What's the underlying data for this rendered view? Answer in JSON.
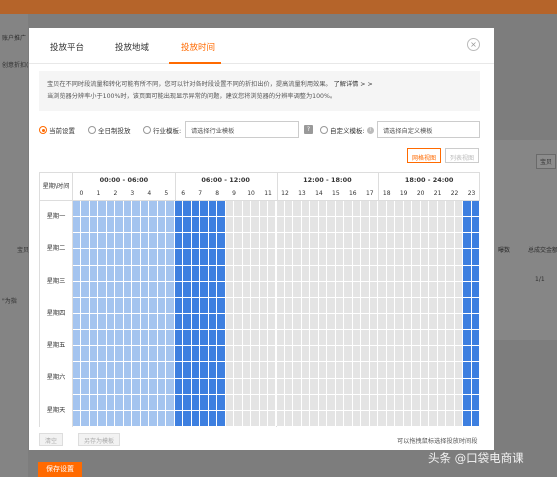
{
  "tabs": [
    {
      "label": "投放平台",
      "active": false
    },
    {
      "label": "投放地域",
      "active": false
    },
    {
      "label": "投放时间",
      "active": true
    }
  ],
  "close_icon": "×",
  "notice": {
    "line1": "宝贝在不同时段流量和转化可能有所不同，您可以针对各时段设置不同的折扣出价，提高流量利用效果。",
    "link": "了解详情 > >",
    "line2": "当浏览器分辨率小于100%时，该页面可能出现显示异常的问题，建议您将浏览器的分辨率调整为100%。"
  },
  "options": {
    "current": "当前设置",
    "allday": "全日制投放",
    "industry": "行业模板:",
    "industry_placeholder": "请选择行业模板",
    "custom": "自定义模板:",
    "custom_placeholder": "请选择自定义模板",
    "help_icon": "?",
    "info_icon": "i"
  },
  "views": {
    "grid": "网格视图",
    "list": "列表视图"
  },
  "grid": {
    "corner": "星期\\时间",
    "periods": [
      "00:00 - 06:00",
      "06:00 - 12:00",
      "12:00 - 18:00",
      "18:00 - 24:00"
    ],
    "hours": [
      "0",
      "1",
      "2",
      "3",
      "4",
      "5",
      "6",
      "7",
      "8",
      "9",
      "10",
      "11",
      "12",
      "13",
      "14",
      "15",
      "16",
      "17",
      "18",
      "19",
      "20",
      "21",
      "22",
      "23"
    ],
    "days": [
      "星期一",
      "星期二",
      "星期三",
      "星期四",
      "星期五",
      "星期六",
      "星期天"
    ]
  },
  "footer": {
    "clear": "清空",
    "save_template": "另存为模板",
    "hint": "可以拖拽鼠标选择投放时间段"
  },
  "save_button": "保存设置",
  "background": {
    "t1": "账户推广",
    "t2": "创意折扣(",
    "t3": "总成交金额",
    "t4": "1/1",
    "t5": "宝贝",
    "t6": "\"为指",
    "t7": "曝数"
  },
  "watermark": "头条 @口袋电商课",
  "colors": {
    "accent": "#ff6a00",
    "selected_dark": "#3d7fe0",
    "selected_light": "#a4c4ef",
    "unselected": "#e4e4e4"
  }
}
